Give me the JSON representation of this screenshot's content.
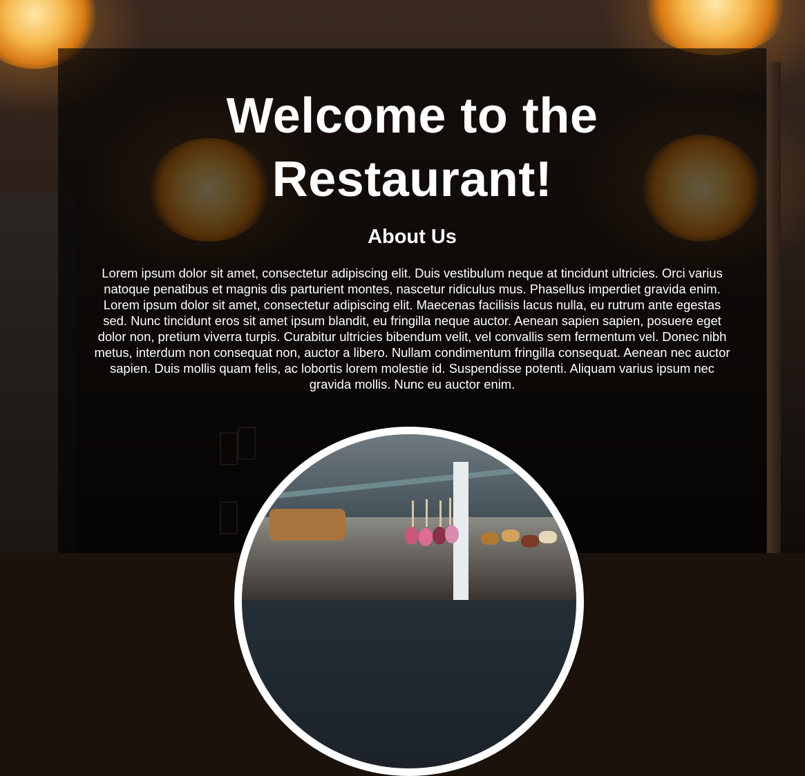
{
  "hero": {
    "title_line1": "Welcome to the",
    "title_line2": "Restaurant!"
  },
  "about": {
    "heading": "About Us",
    "body": "Lorem ipsum dolor sit amet, consectetur adipiscing elit. Duis vestibulum neque at tincidunt ultricies. Orci varius natoque penatibus et magnis dis parturient montes, nascetur ridiculus mus. Phasellus imperdiet gravida enim. Lorem ipsum dolor sit amet, consectetur adipiscing elit. Maecenas facilisis lacus nulla, eu rutrum ante egestas sed. Nunc tincidunt eros sit amet ipsum blandit, eu fringilla neque auctor. Aenean sapien sapien, posuere eget dolor non, pretium viverra turpis. Curabitur ultricies bibendum velit, vel convallis sem fermentum vel. Donec nibh metus, interdum non consequat non, auctor a libero. Nullam condimentum fringilla consequat. Aenean nec auctor sapien. Duis mollis quam felis, ac lobortis lorem molestie id. Suspendisse potenti. Aliquam varius ipsum nec gravida mollis. Nunc eu auctor enim."
  },
  "colors": {
    "overlay": "#000000",
    "text": "#ffffff",
    "lamp_glow": "#f6b94e",
    "photo_border": "#ffffff"
  }
}
